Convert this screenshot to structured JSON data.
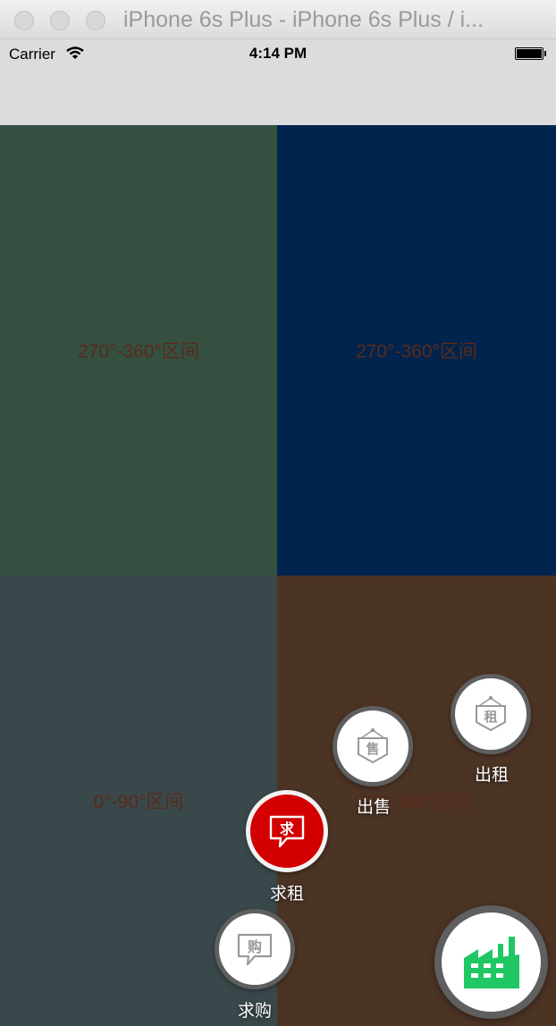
{
  "window": {
    "title": "iPhone 6s Plus - iPhone 6s Plus / i..."
  },
  "status_bar": {
    "carrier": "Carrier",
    "time": "4:14 PM"
  },
  "quadrants": {
    "top_left": {
      "label": "270°-360°区间",
      "color": "#355041"
    },
    "top_right": {
      "label": "270°-360°区间",
      "color": "#00244d"
    },
    "bottom_left": {
      "label": "0°-90°区间",
      "color": "#39494b"
    },
    "bottom_right": {
      "label": "90°-180°区间",
      "color": "#4c3425"
    }
  },
  "menu": {
    "items": [
      {
        "label": "出租",
        "icon_char": "租",
        "icon": "sign-board-icon"
      },
      {
        "label": "出售",
        "icon_char": "售",
        "icon": "sign-board-icon"
      },
      {
        "label": "求租",
        "icon_char": "求",
        "icon": "speech-bubble-icon",
        "active": true
      },
      {
        "label": "求购",
        "icon_char": "购",
        "icon": "speech-bubble-icon"
      }
    ],
    "main_icon": "factory-icon",
    "accent_color": "#d20000",
    "main_icon_color": "#1fc864"
  }
}
